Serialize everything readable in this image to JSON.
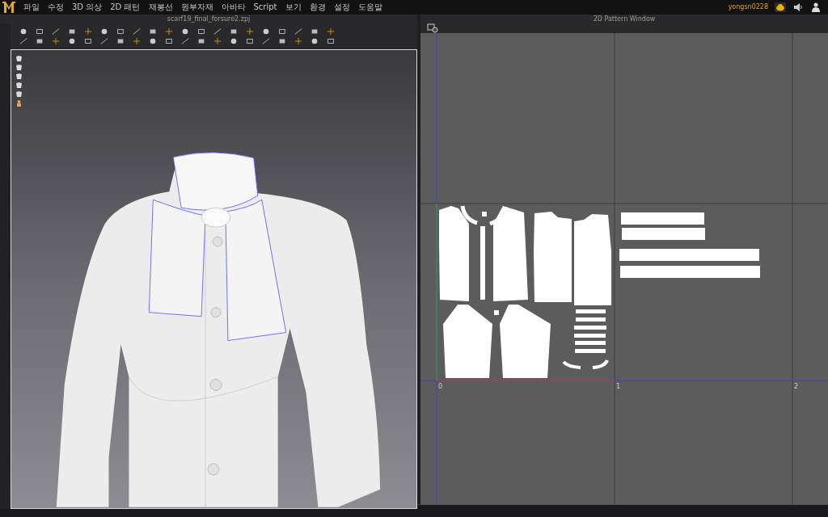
{
  "menu": [
    "파일",
    "수정",
    "3D 의상",
    "2D 패턴",
    "재봉선",
    "원부자재",
    "아바타",
    "Script",
    "보기",
    "환경",
    "설정",
    "도움말"
  ],
  "user": {
    "name": "yongsn0228"
  },
  "window_3d": {
    "title": "scarf19_final_forsure2.zpj"
  },
  "window_2d": {
    "title": "2D Pattern Window",
    "axis_labels": [
      "0",
      "1",
      "2"
    ]
  }
}
